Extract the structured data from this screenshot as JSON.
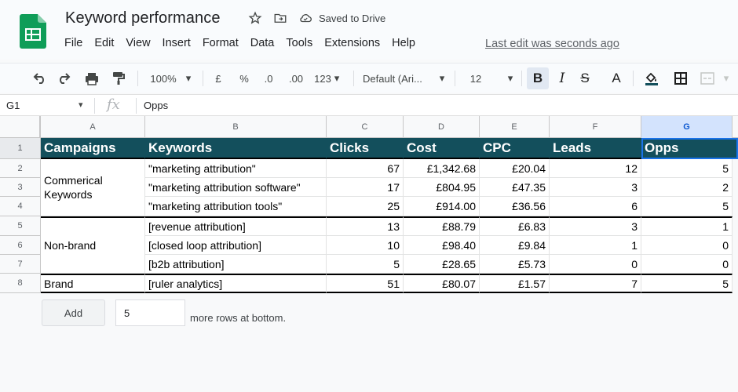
{
  "doc": {
    "title": "Keyword performance",
    "saved_status": "Saved to Drive",
    "last_edit": "Last edit was seconds ago"
  },
  "menu": [
    "File",
    "Edit",
    "View",
    "Insert",
    "Format",
    "Data",
    "Tools",
    "Extensions",
    "Help"
  ],
  "toolbar": {
    "zoom": "100%",
    "currency": "£",
    "percent": "%",
    "dec_decrease": ".0",
    "dec_increase": ".00",
    "more_formats": "123",
    "font": "Default (Ari...",
    "font_size": "12",
    "bold": "B",
    "italic": "I",
    "strike": "S",
    "text_color": "A",
    "caret": "▾"
  },
  "formula_bar": {
    "cell_ref": "G1",
    "fx": "fx",
    "value": "Opps"
  },
  "columns": [
    "A",
    "B",
    "C",
    "D",
    "E",
    "F",
    "G"
  ],
  "rows": [
    "1",
    "2",
    "3",
    "4",
    "5",
    "6",
    "7",
    "8"
  ],
  "table": {
    "headers": [
      "Campaigns",
      "Keywords",
      "Clicks",
      "Cost",
      "CPC",
      "Leads",
      "Opps"
    ],
    "groups": [
      "Commerical Keywords",
      "Non-brand",
      "Brand"
    ],
    "keywords": [
      "\"marketing attribution\"",
      "\"marketing attribution software\"",
      "\"marketing attribution tools\"",
      "[revenue attribution]",
      "[closed loop attribution]",
      "[b2b attribution]",
      "[ruler analytics]"
    ],
    "clicks": [
      "67",
      "17",
      "25",
      "13",
      "10",
      "5",
      "51"
    ],
    "cost": [
      "£1,342.68",
      "£804.95",
      "£914.00",
      "£88.79",
      "£98.40",
      "£28.65",
      "£80.07"
    ],
    "cpc": [
      "£20.04",
      "£47.35",
      "£36.56",
      "£6.83",
      "£9.84",
      "£5.73",
      "£1.57"
    ],
    "leads": [
      "12",
      "3",
      "6",
      "3",
      "1",
      "0",
      "7"
    ],
    "opps": [
      "5",
      "2",
      "5",
      "1",
      "0",
      "0",
      "5"
    ]
  },
  "add_rows": {
    "button": "Add",
    "count": "5",
    "suffix": "more rows at bottom."
  },
  "colors": {
    "header_fill": "#134f5c",
    "sheets_green": "#0f9d58",
    "selection": "#1a73e8"
  }
}
